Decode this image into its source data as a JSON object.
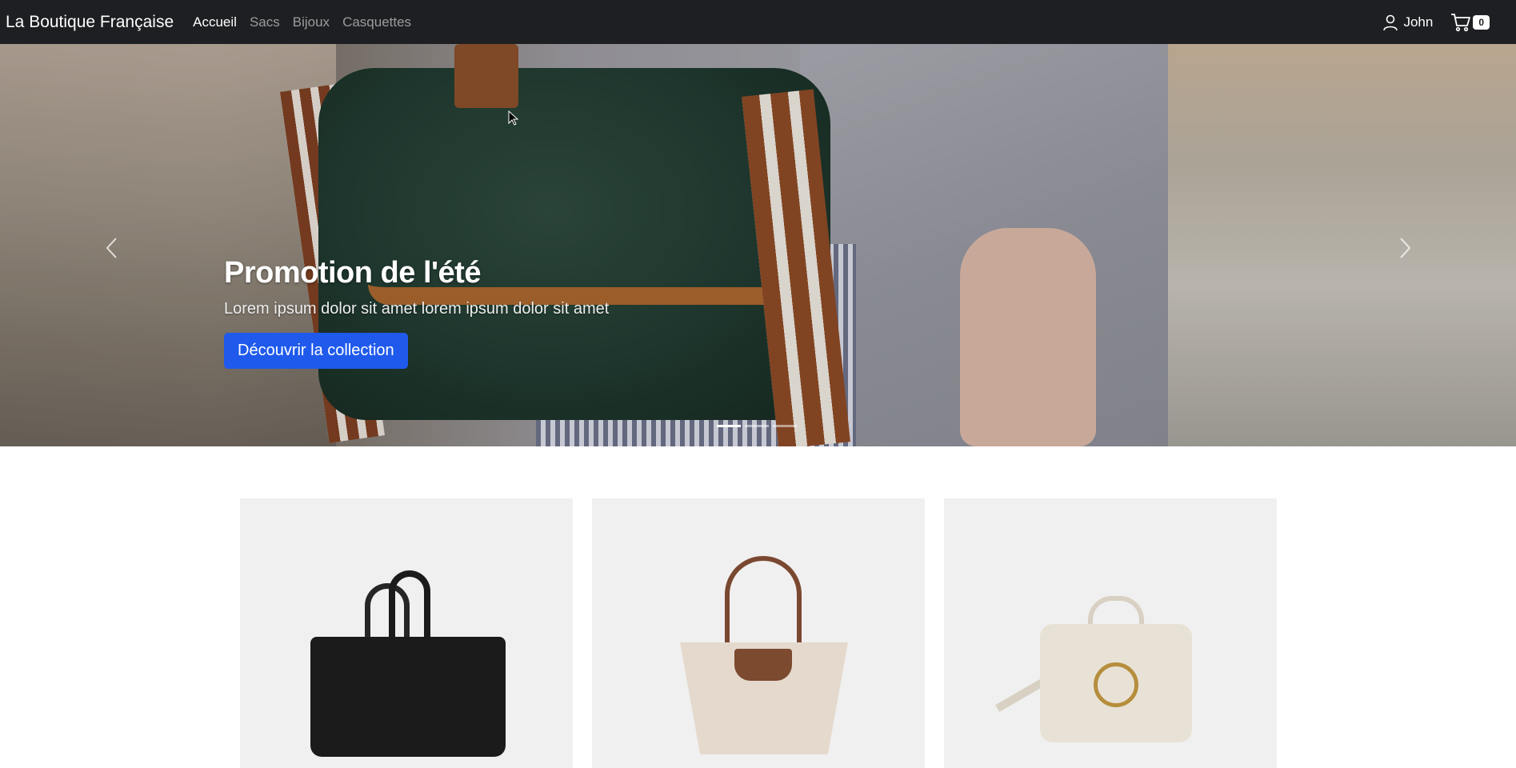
{
  "navbar": {
    "brand": "La Boutique Française",
    "links": [
      {
        "label": "Accueil",
        "active": true
      },
      {
        "label": "Sacs",
        "active": false
      },
      {
        "label": "Bijoux",
        "active": false
      },
      {
        "label": "Casquettes",
        "active": false
      }
    ],
    "user": {
      "name": "John",
      "icon": "user-icon"
    },
    "cart": {
      "count": "0",
      "icon": "cart-icon"
    }
  },
  "hero": {
    "title": "Promotion de l'été",
    "text": "Lorem ipsum dolor sit amet lorem ipsum dolor sit amet",
    "button_label": "Découvrir la collection",
    "button_color": "#1f5aec",
    "indicators": 3,
    "active_indicator": 0,
    "prev_icon": "chevron-left-icon",
    "next_icon": "chevron-right-icon"
  },
  "products": [
    {
      "image": "black-handbag"
    },
    {
      "image": "beige-tote-bag"
    },
    {
      "image": "cream-crossbody-bag"
    }
  ],
  "colors": {
    "navbar_bg": "#1e1f22",
    "card_bg": "#f0f0f0"
  }
}
